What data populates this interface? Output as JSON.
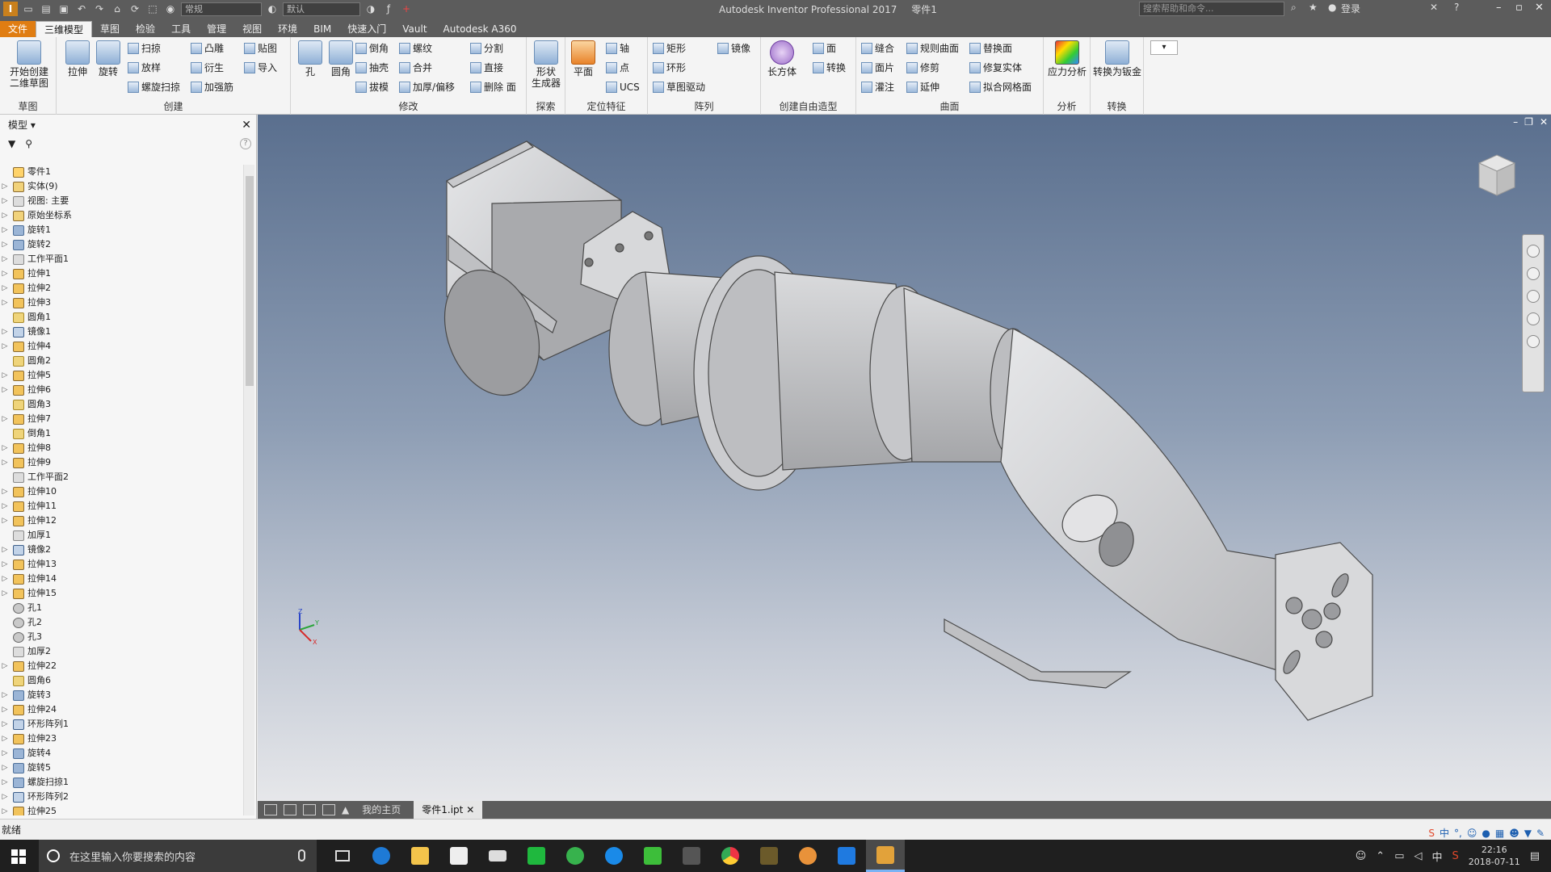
{
  "app": {
    "title": "Autodesk Inventor Professional 2017",
    "document": "零件1",
    "style_dropdown": "常规",
    "appearance_dropdown": "默认",
    "search_placeholder": "搜索帮助和命令...",
    "login": "登录"
  },
  "tabs": [
    "文件",
    "三维模型",
    "草图",
    "检验",
    "工具",
    "管理",
    "视图",
    "环境",
    "BIM",
    "快速入门",
    "Vault",
    "Autodesk A360"
  ],
  "ribbon": {
    "sketch": {
      "label": "草图",
      "start_sketch": "开始创建\n二维草图"
    },
    "create": {
      "label": "创建",
      "extrude": "拉伸",
      "revolve": "旋转",
      "sweep": "扫掠",
      "loft": "放样",
      "coil": "螺旋扫掠",
      "emboss": "凸雕",
      "derive": "衍生",
      "rib": "加强筋",
      "decal": "贴图",
      "import": "导入"
    },
    "modify": {
      "label": "修改",
      "hole": "孔",
      "fillet": "圆角",
      "chamfer": "倒角",
      "shell": "抽壳",
      "draft": "拔模",
      "thread": "螺纹",
      "combine": "合并",
      "thicken": "加厚/偏移",
      "split": "分割",
      "direct": "直接",
      "delete_face": "删除 面"
    },
    "explore": {
      "label": "探索",
      "shape_gen": "形状\n生成器"
    },
    "workfeatures": {
      "label": "定位特征",
      "plane": "平面",
      "axis": "轴",
      "point": "点",
      "ucs": "UCS"
    },
    "pattern": {
      "label": "阵列",
      "rect": "矩形",
      "circ": "环形",
      "sketch_driven": "草图驱动",
      "mirror": "镜像"
    },
    "freeform": {
      "label": "创建自由造型",
      "box": "长方体",
      "face": "面",
      "convert": "转换"
    },
    "surface": {
      "label": "曲面",
      "stitch": "缝合",
      "patch": "面片",
      "sculpt": "灌注",
      "ruled": "规则曲面",
      "trim": "修剪",
      "extend": "延伸",
      "replace_face": "替换面",
      "repair": "修复实体",
      "fit_mesh": "拟合网格面"
    },
    "analysis": {
      "label": "分析",
      "stress": "应力分析"
    },
    "convert": {
      "label": "转换",
      "sheet_metal": "转换为钣金"
    }
  },
  "browser": {
    "title": "模型",
    "root": "零件1",
    "nodes": [
      {
        "label": "实体(9)",
        "icon": "folder",
        "exp": true
      },
      {
        "label": "视图: 主要",
        "icon": "plane",
        "exp": true
      },
      {
        "label": "原始坐标系",
        "icon": "folder",
        "exp": true
      },
      {
        "label": "旋转1",
        "icon": "rev",
        "exp": true
      },
      {
        "label": "旋转2",
        "icon": "rev",
        "exp": true
      },
      {
        "label": "工作平面1",
        "icon": "plane",
        "exp": true
      },
      {
        "label": "拉伸1",
        "icon": "ext",
        "exp": true
      },
      {
        "label": "拉伸2",
        "icon": "ext",
        "exp": true
      },
      {
        "label": "拉伸3",
        "icon": "ext",
        "exp": true
      },
      {
        "label": "圆角1",
        "icon": "fil",
        "exp": false
      },
      {
        "label": "镜像1",
        "icon": "mir",
        "exp": true
      },
      {
        "label": "拉伸4",
        "icon": "ext",
        "exp": true
      },
      {
        "label": "圆角2",
        "icon": "fil",
        "exp": false
      },
      {
        "label": "拉伸5",
        "icon": "ext",
        "exp": true
      },
      {
        "label": "拉伸6",
        "icon": "ext",
        "exp": true
      },
      {
        "label": "圆角3",
        "icon": "fil",
        "exp": false
      },
      {
        "label": "拉伸7",
        "icon": "ext",
        "exp": true
      },
      {
        "label": "倒角1",
        "icon": "fil",
        "exp": false
      },
      {
        "label": "拉伸8",
        "icon": "ext",
        "exp": true
      },
      {
        "label": "拉伸9",
        "icon": "ext",
        "exp": true
      },
      {
        "label": "工作平面2",
        "icon": "plane",
        "exp": false
      },
      {
        "label": "拉伸10",
        "icon": "ext",
        "exp": true
      },
      {
        "label": "拉伸11",
        "icon": "ext",
        "exp": true
      },
      {
        "label": "拉伸12",
        "icon": "ext",
        "exp": true
      },
      {
        "label": "加厚1",
        "icon": "plane",
        "exp": false
      },
      {
        "label": "镜像2",
        "icon": "mir",
        "exp": true
      },
      {
        "label": "拉伸13",
        "icon": "ext",
        "exp": true
      },
      {
        "label": "拉伸14",
        "icon": "ext",
        "exp": true
      },
      {
        "label": "拉伸15",
        "icon": "ext",
        "exp": true
      },
      {
        "label": "孔1",
        "icon": "hole",
        "exp": false
      },
      {
        "label": "孔2",
        "icon": "hole",
        "exp": false
      },
      {
        "label": "孔3",
        "icon": "hole",
        "exp": false
      },
      {
        "label": "加厚2",
        "icon": "plane",
        "exp": false
      },
      {
        "label": "拉伸22",
        "icon": "ext",
        "exp": true
      },
      {
        "label": "圆角6",
        "icon": "fil",
        "exp": false
      },
      {
        "label": "旋转3",
        "icon": "rev",
        "exp": true
      },
      {
        "label": "拉伸24",
        "icon": "ext",
        "exp": true
      },
      {
        "label": "环形阵列1",
        "icon": "mir",
        "exp": true
      },
      {
        "label": "拉伸23",
        "icon": "ext",
        "exp": true
      },
      {
        "label": "旋转4",
        "icon": "rev",
        "exp": true
      },
      {
        "label": "旋转5",
        "icon": "rev",
        "exp": true
      },
      {
        "label": "螺旋扫掠1",
        "icon": "rev",
        "exp": true
      },
      {
        "label": "环形阵列2",
        "icon": "mir",
        "exp": true
      },
      {
        "label": "拉伸25",
        "icon": "ext",
        "exp": true
      }
    ]
  },
  "doc_tabs": {
    "home": "我的主页",
    "active": "零件1.ipt"
  },
  "status": "就绪",
  "taskbar": {
    "search_placeholder": "在这里输入你要搜索的内容",
    "time": "22:16",
    "date": "2018-07-11",
    "ime": "中"
  },
  "colors": {
    "titlebar": "#5c5c5c",
    "file_tab": "#e07d12",
    "viewport_top": "#5a6f8e",
    "viewport_bottom": "#e6e7ea",
    "model": "#cfd0d2"
  }
}
